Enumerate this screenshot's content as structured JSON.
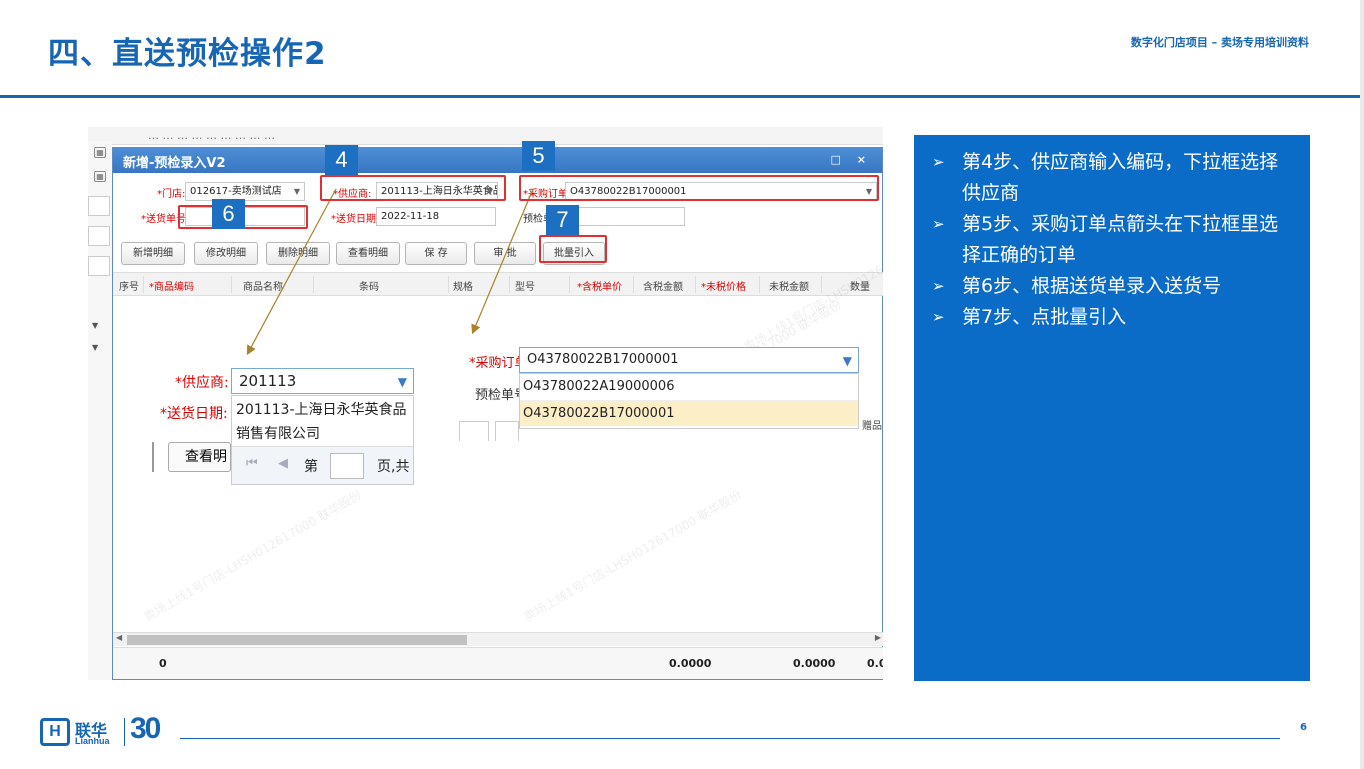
{
  "slide": {
    "title": "四、直送预检操作2",
    "subtitle": "数字化门店项目 – 卖场专用培训资料",
    "page_number": "6"
  },
  "logo": {
    "cn": "联华",
    "en": "Lianhua",
    "anniversary": "30",
    "mark": "H"
  },
  "background_window": {
    "header_hint": "…  …  …  …  …  …  …  …  …"
  },
  "dialog": {
    "title": "新增-预检录入V2",
    "window_controls": "□ ×",
    "store_label": "*门店:",
    "store_value": "012617-卖场测试店",
    "supplier_label": "*供应商:",
    "supplier_value": "201113-上海日永华英食品",
    "po_label": "*采购订单:",
    "po_value": "O43780022B17000001",
    "delivery_no_label": "*送货单号",
    "delivery_no_value": "",
    "delivery_date_label": "*送货日期:",
    "delivery_date_value": "2022-11-18",
    "precheck_label": "预检单",
    "toolbar": {
      "add": "新增明细",
      "edit": "修改明细",
      "delete": "删除明细",
      "view": "查看明细",
      "save": "保 存",
      "approve": "审 批",
      "batch_import": "批量引入"
    },
    "columns": [
      "序号",
      "*商品编码",
      "商品名称",
      "条码",
      "规格",
      "型号",
      "*含税单价",
      "含税金额",
      "*未税价格",
      "未税金额",
      "数量"
    ],
    "footer": {
      "count": "0",
      "tax_amount": "0.0000",
      "notax_amount": "0.0000",
      "qty": "0.0"
    }
  },
  "steps_markers": {
    "s4": "4",
    "s5": "5",
    "s6": "6",
    "s7": "7"
  },
  "zoom_supplier": {
    "label": "*供应商:",
    "input_value": "201113",
    "option": "201113-上海日永华英食品销售有限公司",
    "option_line1": "201113-上海日永华英食品",
    "option_line2": "销售有限公司",
    "date_label": "*送货日期:",
    "view_button": "查看明",
    "pager_page": "第",
    "pager_total": "页,共"
  },
  "zoom_po": {
    "label": "*采购订单:",
    "input_value": "O43780022B17000001",
    "precheck_label": "预检单号:",
    "options": [
      "O43780022A19000006",
      "O43780022B17000001"
    ],
    "side_hint": "赠品"
  },
  "watermark": "卖场上线1号门店-LHSH012617000",
  "watermark2": "联华股份",
  "panel": {
    "bullet_icon": "➢",
    "items": [
      "第4步、供应商输入编码，下拉框选择供应商",
      "第5步、采购订单点箭头在下拉框里选择正确的订单",
      "第6步、根据送货单录入送货号",
      "第7步、点批量引入"
    ]
  },
  "colors": {
    "brand": "#1766b3",
    "panel": "#0b6cc8",
    "highlight": "#e23030",
    "selected_row": "#fcefc8"
  }
}
